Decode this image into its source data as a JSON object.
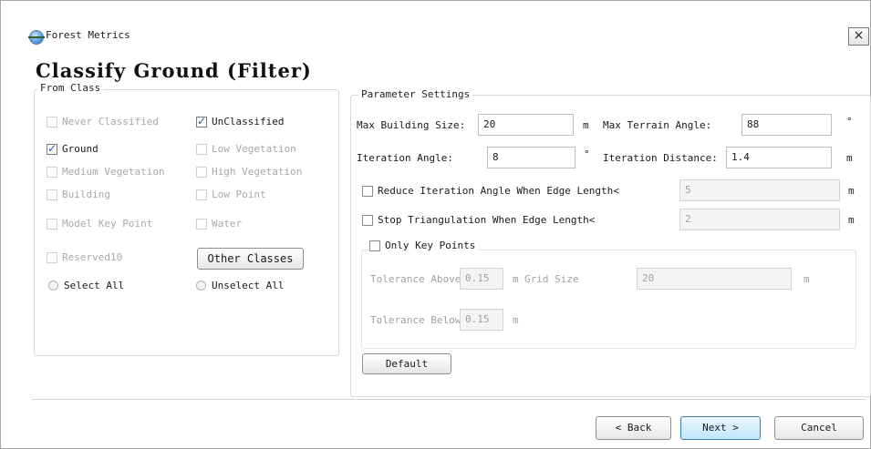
{
  "window": {
    "app_title": "Forest Metrics",
    "close_glyph": "×"
  },
  "page_title": "Classify Ground (Filter)",
  "from_class": {
    "label": "From Class",
    "classes": [
      {
        "label": "Never Classified",
        "checked": false,
        "enabled": false
      },
      {
        "label": "UnClassified",
        "checked": true,
        "enabled": true
      },
      {
        "label": "Ground",
        "checked": true,
        "enabled": true
      },
      {
        "label": "Low Vegetation",
        "checked": false,
        "enabled": false
      },
      {
        "label": "Medium Vegetation",
        "checked": false,
        "enabled": false
      },
      {
        "label": "High Vegetation",
        "checked": false,
        "enabled": false
      },
      {
        "label": "Building",
        "checked": false,
        "enabled": false
      },
      {
        "label": "Low Point",
        "checked": false,
        "enabled": false
      },
      {
        "label": "Model Key Point",
        "checked": false,
        "enabled": false
      },
      {
        "label": "Water",
        "checked": false,
        "enabled": false
      },
      {
        "label": "Reserved10",
        "checked": false,
        "enabled": false
      }
    ],
    "other_classes_button": "Other Classes",
    "select_all": "Select All",
    "unselect_all": "Unselect All"
  },
  "params": {
    "label": "Parameter Settings",
    "max_building_size": {
      "label": "Max Building Size:",
      "value": "20",
      "unit": "m"
    },
    "max_terrain_angle": {
      "label": "Max Terrain Angle:",
      "value": "88",
      "unit": "°"
    },
    "iteration_angle": {
      "label": "Iteration Angle:",
      "value": "8",
      "unit": "°"
    },
    "iteration_distance": {
      "label": "Iteration Distance:",
      "value": "1.4",
      "unit": "m"
    },
    "reduce_iteration": {
      "label": "Reduce Iteration Angle When Edge Length<",
      "value": "5",
      "unit": "m",
      "checked": false
    },
    "stop_triangulation": {
      "label": "Stop Triangulation When Edge Length<",
      "value": "2",
      "unit": "m",
      "checked": false
    },
    "only_key_points": {
      "label": "Only Key Points",
      "checked": false
    },
    "tolerance_above": {
      "label": "Tolerance Above",
      "value": "0.15",
      "unit": "m"
    },
    "grid_size": {
      "label": "Grid Size",
      "value": "20",
      "unit": "m"
    },
    "tolerance_below": {
      "label": "Tolerance Below",
      "value": "0.15",
      "unit": "m"
    },
    "default_button": "Default"
  },
  "footer": {
    "back": "< Back",
    "next": "Next >",
    "cancel": "Cancel"
  }
}
